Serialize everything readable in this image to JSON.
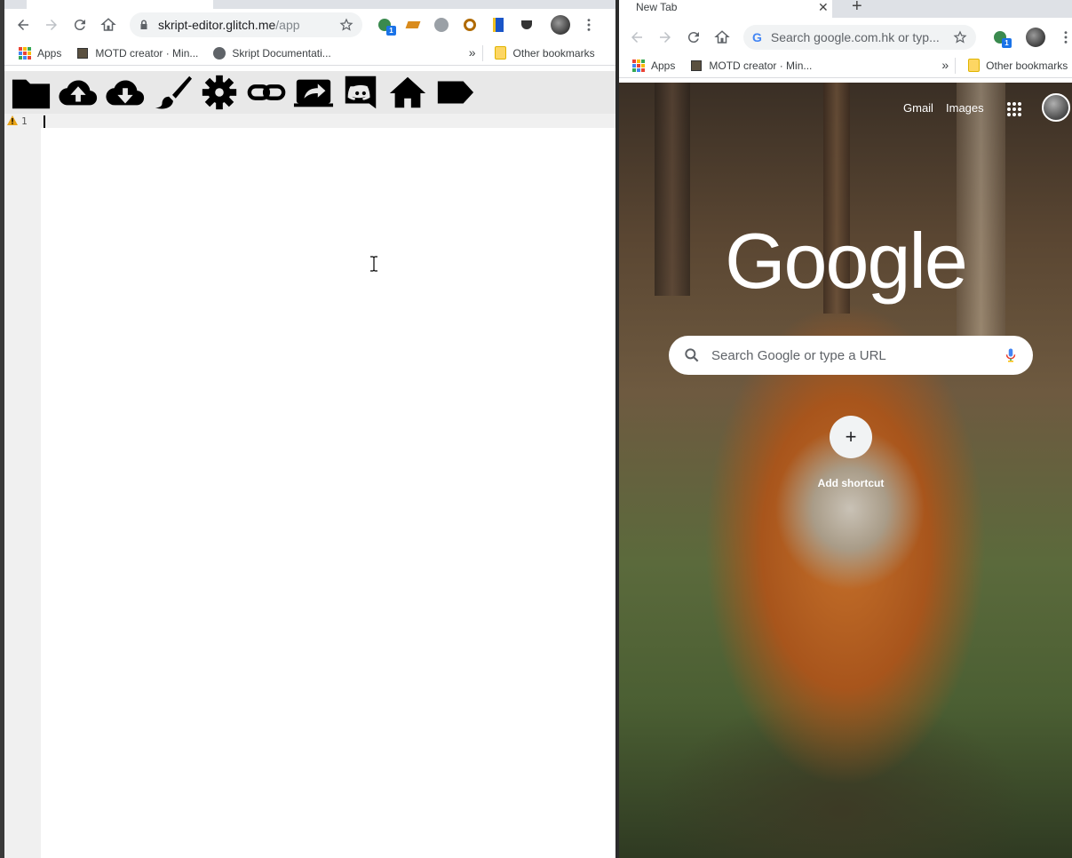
{
  "left": {
    "url_host": "skript-editor.glitch.me",
    "url_path": "/app",
    "bookmarks": {
      "apps": "Apps",
      "motd": "MOTD creator · Min...",
      "skript": "Skript Documentati...",
      "more": "»",
      "other": "Other bookmarks"
    },
    "extension_badge": "1",
    "toolbar_icons": [
      "folder-icon",
      "cloud-upload-icon",
      "cloud-download-icon",
      "paint-brush-icon",
      "gear-icon",
      "link-icon",
      "share-icon",
      "discord-icon",
      "home-icon",
      "tag-icon"
    ],
    "editor": {
      "line_number": "1",
      "content": ""
    }
  },
  "right": {
    "tab_title": "New Tab",
    "tab_close": "✕",
    "new_tab": "+",
    "omnibox_placeholder": "Search google.com.hk or typ...",
    "extension_badge": "1",
    "bookmarks": {
      "apps": "Apps",
      "motd": "MOTD creator · Min...",
      "more": "»",
      "other": "Other bookmarks"
    },
    "ntp": {
      "gmail": "Gmail",
      "images": "Images",
      "logo": "Google",
      "search_placeholder": "Search Google or type a URL",
      "shortcut_plus": "+",
      "add_shortcut": "Add shortcut"
    }
  },
  "colors": {
    "google_blue": "#1a73e8",
    "editor_gutter": "#f0f0f0",
    "toolbar_bg": "#e8e8e8",
    "fox_orange": "#c5702a"
  }
}
